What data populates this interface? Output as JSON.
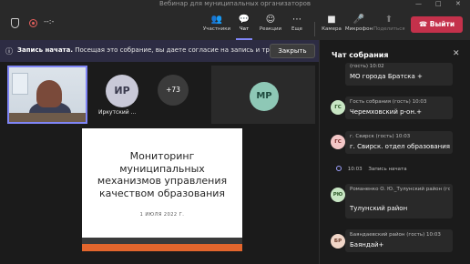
{
  "window": {
    "title": "Вебинар для муниципальных организаторов",
    "controls": [
      "—",
      "□",
      "✕"
    ]
  },
  "toolbar": {
    "timer": "--:-",
    "buttons": [
      {
        "label": "Участники",
        "icon": "people-icon",
        "glyph": "👥"
      },
      {
        "label": "Чат",
        "icon": "chat-icon",
        "glyph": "💬"
      },
      {
        "label": "Реакции",
        "icon": "smile-icon",
        "glyph": "☺"
      },
      {
        "label": "Еще",
        "icon": "more-icon",
        "glyph": "⋯"
      },
      {
        "label": "Камера",
        "icon": "camera-icon",
        "glyph": "■"
      },
      {
        "label": "Микрофон",
        "icon": "microphone-icon",
        "glyph": "🎤"
      },
      {
        "label": "Поделиться",
        "icon": "share-icon",
        "glyph": "⬆"
      }
    ],
    "leave_icon": "☎",
    "leave_label": "Выйти"
  },
  "banner": {
    "bold": "Запись начата.",
    "text": "Посещая это собрание, вы даете согласие на запись и транс...",
    "close_label": "Закрыть"
  },
  "participants": {
    "ir_initials": "ИР",
    "ir_name": "Иркутский ...",
    "more": "+73",
    "mr_initials": "МР"
  },
  "slide": {
    "title": "Мониторинг муниципальных механизмов управления качеством образования",
    "date": "1 ИЮЛЯ 2022 Г."
  },
  "chat": {
    "title": "Чат собрания",
    "close": "✕",
    "messages": [
      {
        "header": "(гость)   10:02",
        "text": "МО города Братска +"
      },
      {
        "initials": "ГС",
        "header": "Гость собрания (гость)   10:03",
        "text": "Черемховский р-он.+",
        "avatar_bg": "#c8e6c4",
        "avatar_fg": "#2f5a2a"
      },
      {
        "initials": "ГС",
        "header": "г. Свирск (гость)   10:03",
        "text": "г. Свирск. отдел образования",
        "avatar_bg": "#f3c7c7",
        "avatar_fg": "#7a2a2a"
      },
      {
        "initials": "РЮ",
        "header": "Романенко О. Ю._Тулунский район (гость)   10:03",
        "text": "Тулунский район",
        "avatar_bg": "#c8e6c4",
        "avatar_fg": "#2f5a2a"
      },
      {
        "initials": "БР",
        "header": "Баяндаевский район (гость)   10:03",
        "text": "Баяндай+",
        "avatar_bg": "#f0d6c8",
        "avatar_fg": "#6b3b2a"
      }
    ],
    "system": {
      "time": "10:03",
      "text": "Запись начата"
    }
  }
}
